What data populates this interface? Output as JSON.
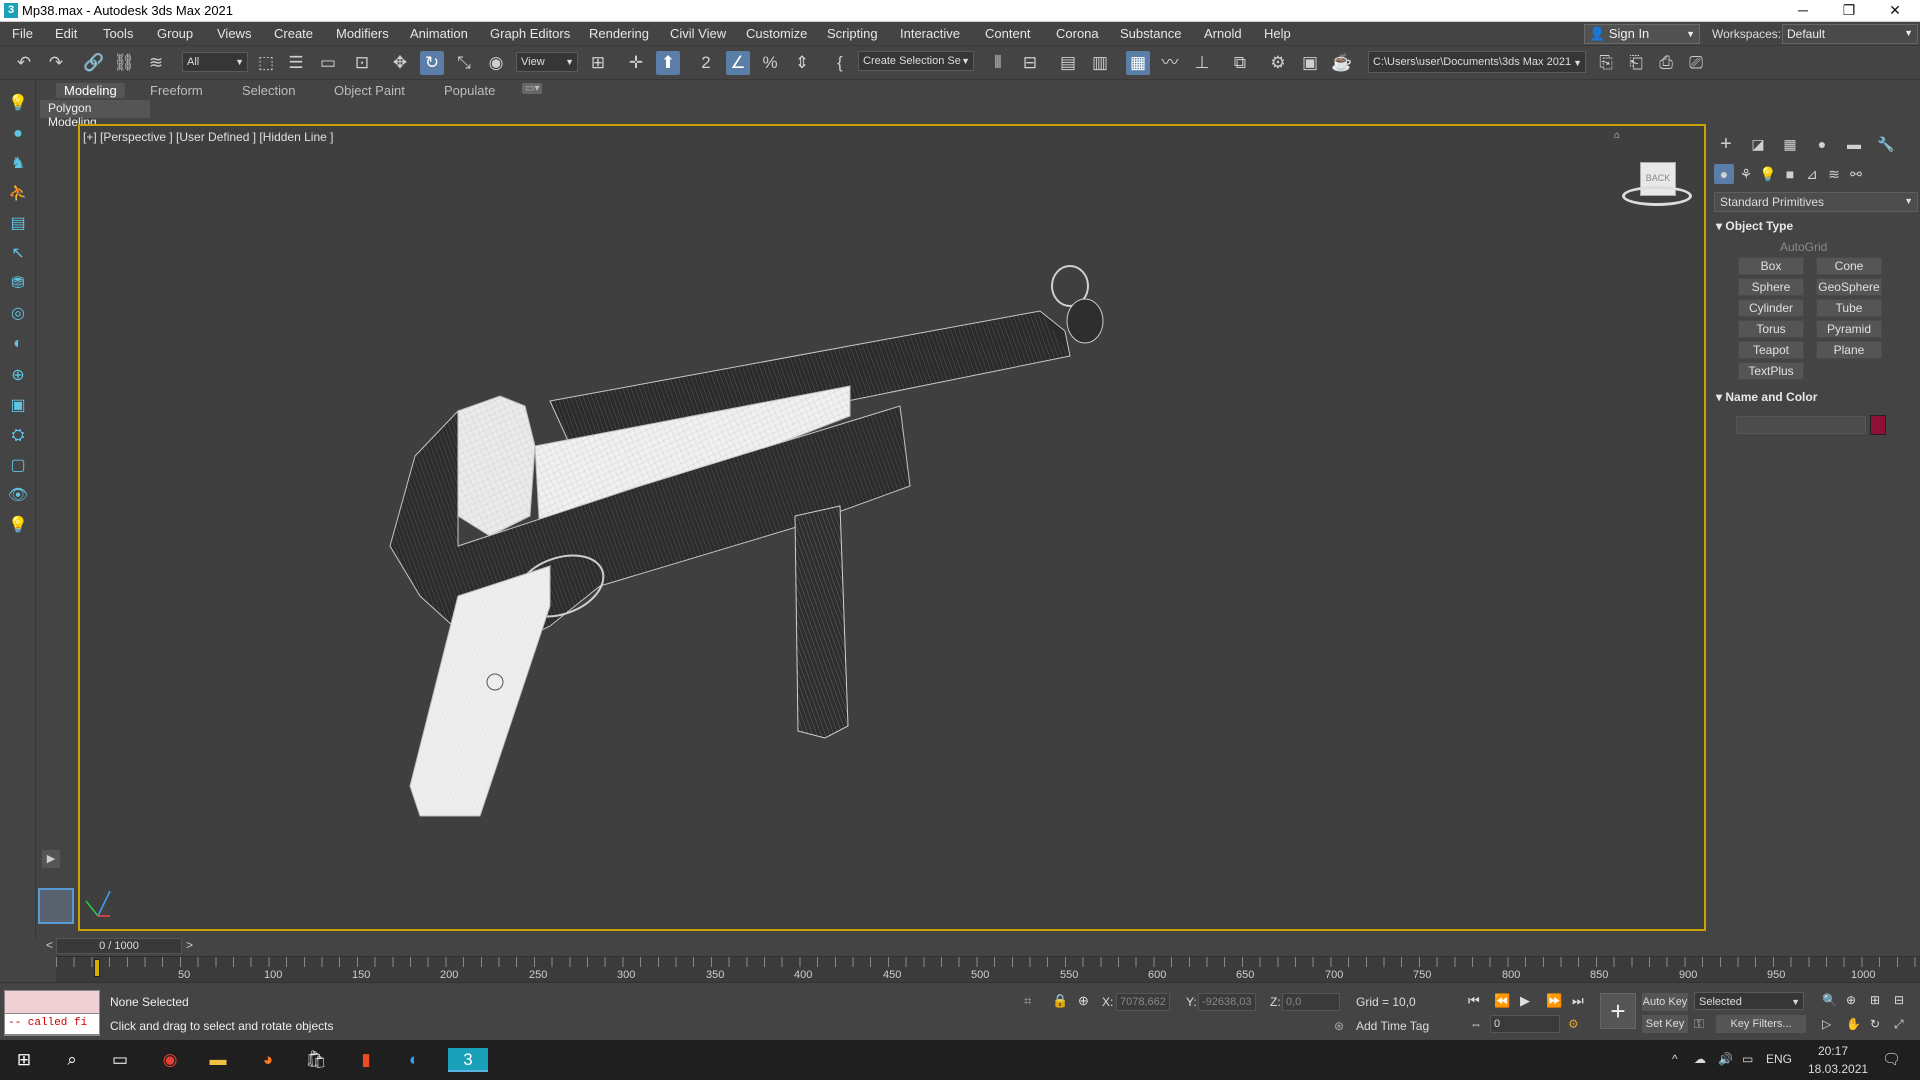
{
  "window": {
    "title": "Mp38.max - Autodesk 3ds Max 2021",
    "logo": "3"
  },
  "menu": [
    "File",
    "Edit",
    "Tools",
    "Group",
    "Views",
    "Create",
    "Modifiers",
    "Animation",
    "Graph Editors",
    "Rendering",
    "Civil View",
    "Customize",
    "Scripting",
    "Interactive",
    "Content",
    "Corona",
    "Substance",
    "Arnold",
    "Help"
  ],
  "account": {
    "sign_in": "Sign In",
    "workspaces_label": "Workspaces:",
    "workspace": "Default"
  },
  "toolbar": {
    "selection_filter": "All",
    "ref_coord": "View",
    "selection_set": "Create Selection Se",
    "project_path": "C:\\Users\\user\\Documents\\3ds Max 2021"
  },
  "ribbon": {
    "tabs": [
      "Modeling",
      "Freeform",
      "Selection",
      "Object Paint",
      "Populate"
    ],
    "active": "Modeling",
    "panel": "Polygon Modeling"
  },
  "viewport": {
    "label": "[+] [Perspective ] [User Defined ] [Hidden Line ]",
    "viewcube_face": "BACK"
  },
  "command_panel": {
    "category": "Standard Primitives",
    "object_type_title": "Object Type",
    "autogrid": "AutoGrid",
    "buttons": [
      "Box",
      "Cone",
      "Sphere",
      "GeoSphere",
      "Cylinder",
      "Tube",
      "Torus",
      "Pyramid",
      "Teapot",
      "Plane",
      "TextPlus"
    ],
    "name_color_title": "Name and Color",
    "color": "#8e1036"
  },
  "timeline": {
    "frame": "0 / 1000",
    "ticks": [
      "50",
      "100",
      "150",
      "200",
      "250",
      "300",
      "350",
      "400",
      "450",
      "500",
      "550",
      "600",
      "650",
      "700",
      "750",
      "800",
      "850",
      "900",
      "950",
      "1000"
    ]
  },
  "status": {
    "selection": "None Selected",
    "prompt": "Click and drag to select and rotate objects",
    "maxscript_output": "-- called fi",
    "x_label": "X:",
    "x": "7078,662",
    "y_label": "Y:",
    "y": "-92638,03",
    "z_label": "Z:",
    "z": "0,0",
    "grid": "Grid = 10,0",
    "add_time_tag": "Add Time Tag",
    "auto_key": "Auto Key",
    "set_key": "Set Key",
    "key_mode": "Selected",
    "key_filters": "Key Filters...",
    "current_frame": "0"
  },
  "taskbar": {
    "lang": "ENG",
    "time": "20:17",
    "date": "18.03.2021"
  }
}
